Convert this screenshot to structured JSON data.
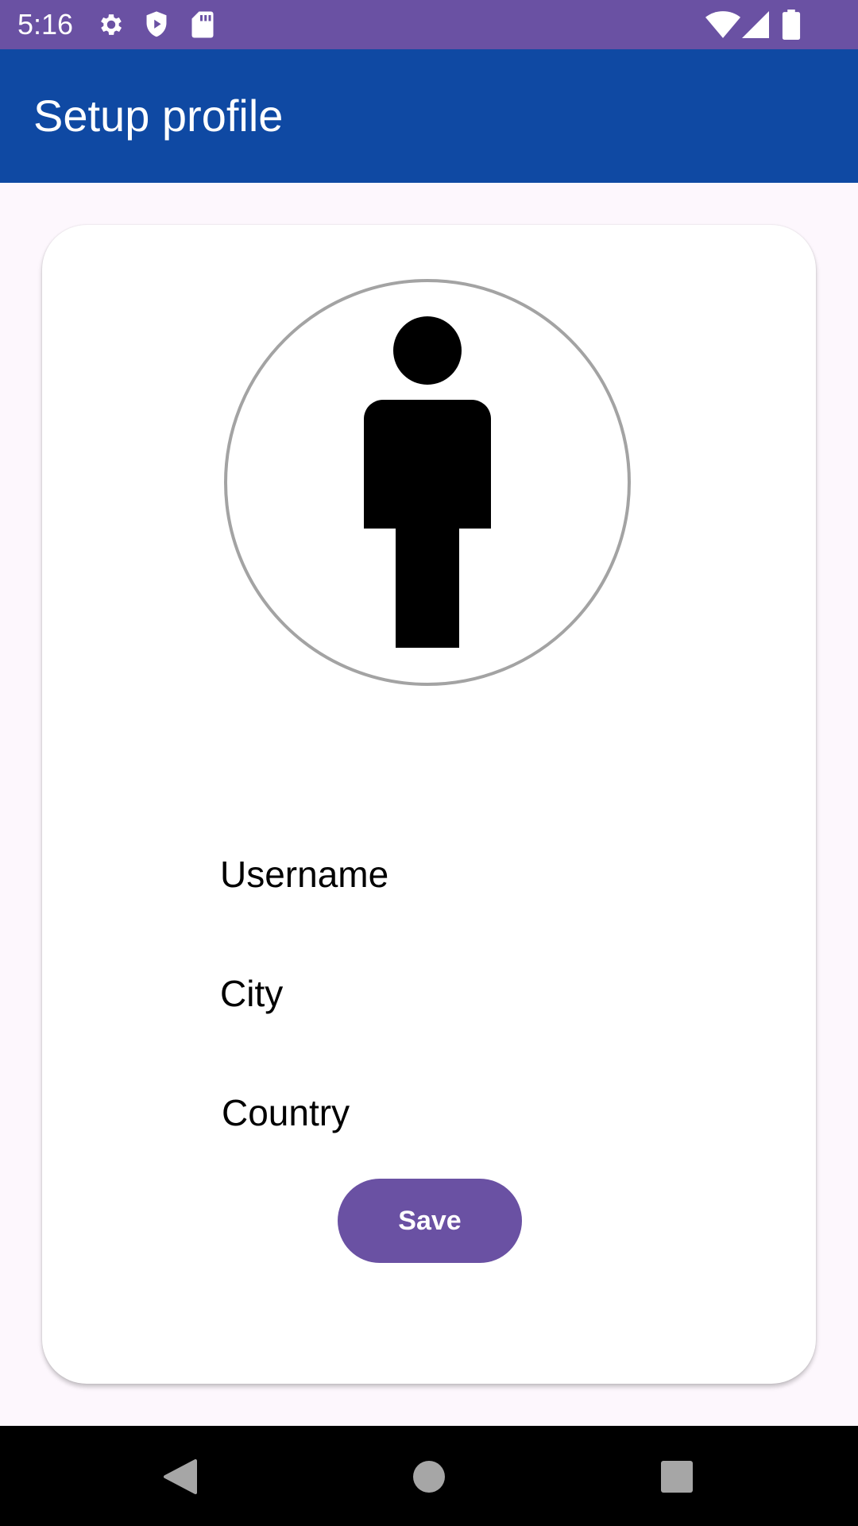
{
  "status_bar": {
    "time": "5:16",
    "left_icons": [
      "gear-icon",
      "shield-play-icon",
      "sd-card-icon"
    ],
    "right_icons": [
      "wifi-icon",
      "cell-signal-icon",
      "battery-icon"
    ],
    "color": "#6a51a3"
  },
  "app_bar": {
    "title": "Setup profile",
    "color": "#0f49a3"
  },
  "profile": {
    "avatar_icon": "person-icon",
    "fields": {
      "username_placeholder": "Username",
      "city_placeholder": "City",
      "country_placeholder": "Country"
    },
    "save_label": "Save",
    "accent": "#6a51a3"
  },
  "nav_bar": {
    "buttons": [
      "back-icon",
      "home-icon",
      "recents-icon"
    ]
  }
}
